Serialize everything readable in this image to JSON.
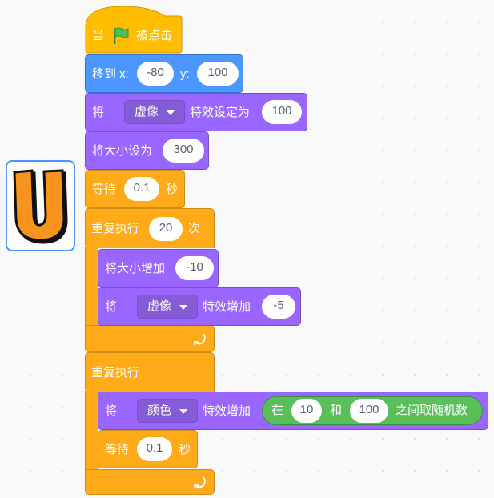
{
  "sprite_thumbnail": {
    "icon": "letter-u-sprite",
    "label": "U"
  },
  "script": {
    "hat": {
      "when": "当",
      "clicked": "被点击",
      "flag_icon": "green-flag"
    },
    "goto": {
      "label": "移到 x:",
      "x": "-80",
      "y_label": "y:",
      "y": "100"
    },
    "set_effect": {
      "verb": "将",
      "effect": "虚像",
      "label": "特效设定为",
      "value": "100"
    },
    "set_size": {
      "label": "将大小设为",
      "value": "300"
    },
    "wait1": {
      "label": "等待",
      "value": "0.1",
      "unit": "秒"
    },
    "repeat": {
      "label": "重复执行",
      "times": "20",
      "unit": "次",
      "change_size": {
        "label": "将大小增加",
        "value": "-10"
      },
      "change_effect": {
        "verb": "将",
        "effect": "虚像",
        "label": "特效增加",
        "value": "-5"
      }
    },
    "forever": {
      "label": "重复执行",
      "change_effect": {
        "verb": "将",
        "effect": "颜色",
        "label": "特效增加",
        "random": {
          "prefix": "在",
          "from": "10",
          "and": "和",
          "to": "100",
          "suffix": "之间取随机数"
        }
      },
      "wait": {
        "label": "等待",
        "value": "0.1",
        "unit": "秒"
      }
    }
  },
  "colors": {
    "events": "#ffbf00",
    "control": "#ffab19",
    "motion": "#4c97ff",
    "looks": "#9966ff",
    "operators": "#59c059",
    "flag": "#4cbf56"
  }
}
